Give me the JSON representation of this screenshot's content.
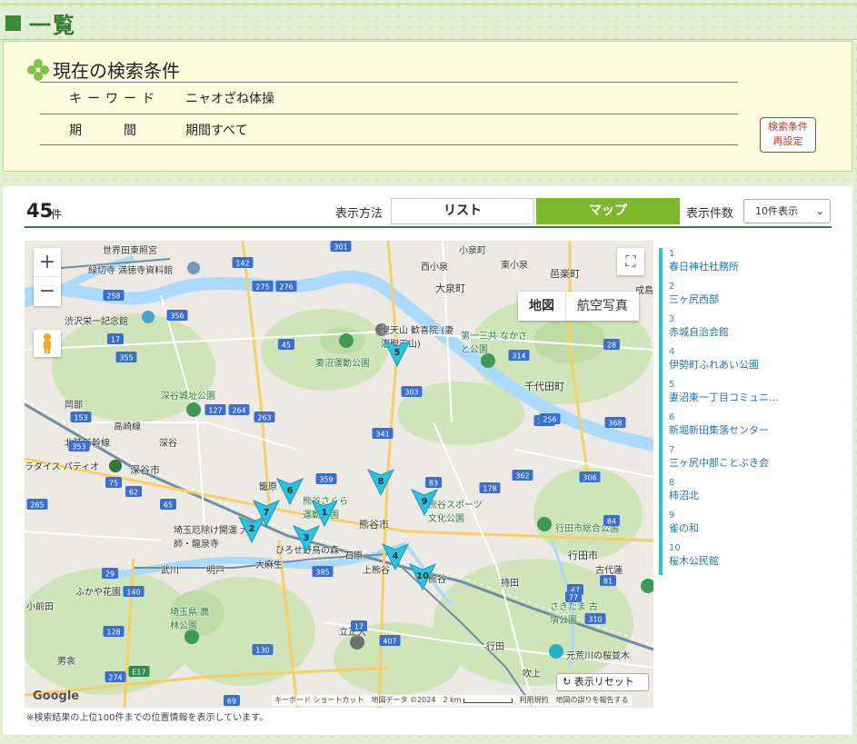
{
  "page": {
    "heading": "一覧"
  },
  "conditions": {
    "title": "現在の検索条件",
    "keyword_label": "キーワード",
    "keyword_value": "ニャオざね体操",
    "period_label": "期間",
    "period_value": "期間すべて",
    "reset_button_line1": "検索条件",
    "reset_button_line2": "再設定"
  },
  "results": {
    "count": "45",
    "count_unit": "件",
    "display_method_label": "表示方法",
    "list_button": "リスト",
    "map_button": "マップ",
    "per_page_label": "表示件数",
    "per_page_value": "10件表示",
    "note": "※検索結果の上位100件までの位置情報を表示しています。"
  },
  "map": {
    "zoom_in": "+",
    "zoom_out": "−",
    "map_type_map": "地図",
    "map_type_aerial": "航空写真",
    "reset_view_label": "表示リセット",
    "logo": "Google",
    "attrib_shortcut": "キーボード ショートカット",
    "attrib_data": "地図データ ©2024",
    "scale_label": "2 km",
    "attrib_terms": "利用規約",
    "attrib_report": "地図の誤りを報告する",
    "labels": [
      {
        "text": "世界田東照宮",
        "kind": "normal"
      },
      {
        "text": "緑切寺 満徳寺資料館",
        "kind": "normal"
      },
      {
        "text": "渋沢栄一記念館",
        "kind": "normal"
      },
      {
        "text": "深谷城址公園",
        "kind": "green"
      },
      {
        "text": "深谷市",
        "kind": "big"
      },
      {
        "text": "深谷",
        "kind": "normal"
      },
      {
        "text": "ラダイス パティオ",
        "kind": "normal"
      },
      {
        "text": "岡部",
        "kind": "normal"
      },
      {
        "text": "高崎線",
        "kind": "normal"
      },
      {
        "text": "北陸新幹線",
        "kind": "normal"
      },
      {
        "text": "大泉町",
        "kind": "big"
      },
      {
        "text": "西小泉",
        "kind": "normal"
      },
      {
        "text": "小泉町",
        "kind": "normal"
      },
      {
        "text": "東小泉",
        "kind": "normal"
      },
      {
        "text": "邑楽町",
        "kind": "big"
      },
      {
        "text": "千代田町",
        "kind": "big"
      },
      {
        "text": "妻沼運動公園",
        "kind": "green"
      },
      {
        "text": "聖天山 歓喜院 (妻沼聖天山)",
        "kind": "normal"
      },
      {
        "text": "第一三共 なかさと公園",
        "kind": "green"
      },
      {
        "text": "籠原",
        "kind": "normal"
      },
      {
        "text": "熊谷さくら 運動公園",
        "kind": "green"
      },
      {
        "text": "熊谷市",
        "kind": "big"
      },
      {
        "text": "熊谷スポーツ 文化公園",
        "kind": "green"
      },
      {
        "text": "埼玉厄除け開運 大師・龍泉寺",
        "kind": "normal"
      },
      {
        "text": "ひろせ野鳥の森",
        "kind": "normal"
      },
      {
        "text": "石原",
        "kind": "normal"
      },
      {
        "text": "大麻生",
        "kind": "normal"
      },
      {
        "text": "上熊谷",
        "kind": "normal"
      },
      {
        "text": "熊谷",
        "kind": "normal"
      },
      {
        "text": "行田市総合公園",
        "kind": "green"
      },
      {
        "text": "行田市",
        "kind": "big"
      },
      {
        "text": "持田",
        "kind": "normal"
      },
      {
        "text": "古代蓮",
        "kind": "normal"
      },
      {
        "text": "武川",
        "kind": "normal"
      },
      {
        "text": "明戸",
        "kind": "normal"
      },
      {
        "text": "ふかや花園",
        "kind": "normal"
      },
      {
        "text": "小前田",
        "kind": "normal"
      },
      {
        "text": "埼玉県 農林公園",
        "kind": "green"
      },
      {
        "text": "立正大",
        "kind": "normal"
      },
      {
        "text": "さきたま 古墳公園",
        "kind": "green"
      },
      {
        "text": "元荒川の桜並木",
        "kind": "normal"
      },
      {
        "text": "吹上",
        "kind": "normal"
      },
      {
        "text": "行田",
        "kind": "normal"
      },
      {
        "text": "男衾",
        "kind": "normal"
      },
      {
        "text": "成島",
        "kind": "normal"
      }
    ],
    "route_numbers": [
      "142",
      "275",
      "276",
      "301",
      "258",
      "356",
      "17",
      "45",
      "355",
      "127",
      "264",
      "263",
      "303",
      "359",
      "341",
      "153",
      "353",
      "314",
      "368",
      "383",
      "83",
      "362",
      "178",
      "306",
      "265",
      "75",
      "62",
      "65",
      "140",
      "385",
      "407",
      "128",
      "130",
      "274",
      "E17",
      "69",
      "29",
      "17",
      "81",
      "47",
      "28",
      "256",
      "84",
      "77",
      "310"
    ],
    "markers": [
      "1",
      "2",
      "3",
      "4",
      "5",
      "6",
      "7",
      "8",
      "9",
      "10"
    ]
  },
  "side_list": [
    {
      "num": "1",
      "name": "春日神社社務所"
    },
    {
      "num": "2",
      "name": "三ヶ尻西部"
    },
    {
      "num": "3",
      "name": "赤城自治会館"
    },
    {
      "num": "4",
      "name": "伊勢町ふれあい公園"
    },
    {
      "num": "5",
      "name": "妻沼東一丁目コミュニ…"
    },
    {
      "num": "6",
      "name": "新堀新田集落センター"
    },
    {
      "num": "7",
      "name": "三ヶ尻中部ことぶき会"
    },
    {
      "num": "8",
      "name": "柿沼北"
    },
    {
      "num": "9",
      "name": "雀の和"
    },
    {
      "num": "10",
      "name": "桜木公民館"
    }
  ],
  "colors": {
    "accent_green": "#7cb92c",
    "heading_green": "#2f7a2f",
    "marker_cyan": "#2cc3e0",
    "link_blue": "#2275b8",
    "reset_red": "#c0392b",
    "river_blue": "#aadaff"
  }
}
